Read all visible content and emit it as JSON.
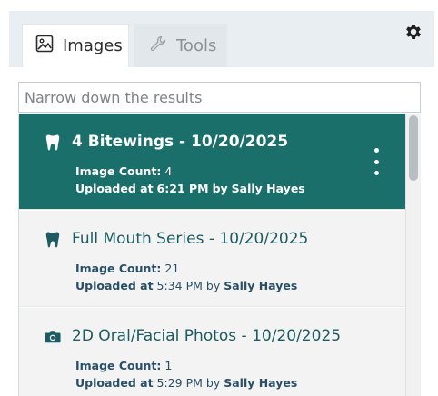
{
  "tabs": {
    "images_label": "Images",
    "tools_label": "Tools"
  },
  "search": {
    "placeholder": "Narrow down the results"
  },
  "labels": {
    "image_count": "Image Count:",
    "uploaded_at": "Uploaded at",
    "by": "by"
  },
  "items": [
    {
      "title": "4 Bitewings - 10/20/2025",
      "icon": "tooth-icon",
      "image_count": "4",
      "time": "6:21 PM",
      "user": "Sally Hayes",
      "selected": true
    },
    {
      "title": "Full Mouth Series - 10/20/2025",
      "icon": "tooth-icon",
      "image_count": "21",
      "time": "5:34 PM",
      "user": "Sally Hayes",
      "selected": false
    },
    {
      "title": "2D Oral/Facial Photos - 10/20/2025",
      "icon": "camera-icon",
      "image_count": "1",
      "time": "5:29 PM",
      "user": "Sally Hayes",
      "selected": false
    }
  ],
  "colors": {
    "selected_bg": "#1b6f6b",
    "title_teal": "#1c5b62",
    "tab_bar_bg": "#e9eef2"
  },
  "scrollbar": {
    "position_fraction": 0.0
  }
}
